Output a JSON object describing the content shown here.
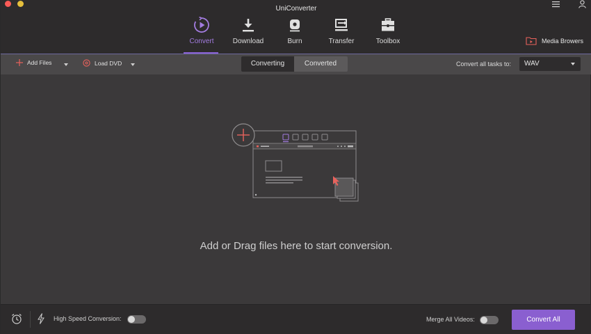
{
  "window": {
    "title": "UniConverter"
  },
  "colors": {
    "accent": "#8a5fd0",
    "active_nav": "#a37ce0",
    "close_dot": "#fc5b57",
    "minimize_dot": "#e5bf3c",
    "illustration_red": "#e8625c"
  },
  "nav": {
    "items": [
      {
        "label": "Convert",
        "icon": "convert-play-icon",
        "active": true
      },
      {
        "label": "Download",
        "icon": "download-icon",
        "active": false
      },
      {
        "label": "Burn",
        "icon": "disc-icon",
        "active": false
      },
      {
        "label": "Transfer",
        "icon": "transfer-icon",
        "active": false
      },
      {
        "label": "Toolbox",
        "icon": "toolbox-icon",
        "active": false
      }
    ],
    "media_browser_label": "Media Browers"
  },
  "toolbar": {
    "add_files_label": "Add Files",
    "load_dvd_label": "Load DVD",
    "tabs": [
      {
        "label": "Converting",
        "active": true
      },
      {
        "label": "Converted",
        "active": false
      }
    ],
    "convert_all_tasks_label": "Convert all tasks to:",
    "format_value": "WAV"
  },
  "dropzone": {
    "hint": "Add or Drag files here to start conversion."
  },
  "bottom": {
    "high_speed_label": "High Speed Conversion:",
    "high_speed_on": false,
    "merge_label": "Merge All Videos:",
    "merge_on": false,
    "convert_all_label": "Convert All"
  }
}
